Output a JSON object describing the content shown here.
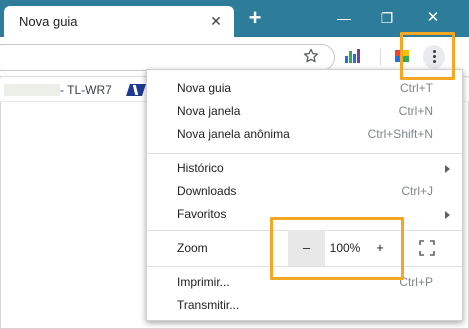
{
  "browser": {
    "tab": {
      "title": "Nova guia",
      "close_glyph": "✕"
    },
    "new_tab_glyph": "+",
    "window_controls": {
      "minimize": "—",
      "maximize": "❐",
      "close": "✕"
    }
  },
  "bookmarks_bar": {
    "item_text": "- TL-WR7"
  },
  "menu": {
    "items": [
      {
        "label": "Nova guia",
        "shortcut": "Ctrl+T"
      },
      {
        "label": "Nova janela",
        "shortcut": "Ctrl+N"
      },
      {
        "label": "Nova janela anônima",
        "shortcut": "Ctrl+Shift+N"
      },
      {
        "label": "Histórico",
        "shortcut": ""
      },
      {
        "label": "Downloads",
        "shortcut": "Ctrl+J"
      },
      {
        "label": "Favoritos",
        "shortcut": ""
      },
      {
        "label": "Imprimir...",
        "shortcut": "Ctrl+P"
      },
      {
        "label": "Transmitir...",
        "shortcut": ""
      }
    ],
    "zoom": {
      "label": "Zoom",
      "minus": "–",
      "value": "100%",
      "plus": "+"
    }
  },
  "colors": {
    "titlebar": "#2d7d9a",
    "highlight": "#f5a623"
  }
}
